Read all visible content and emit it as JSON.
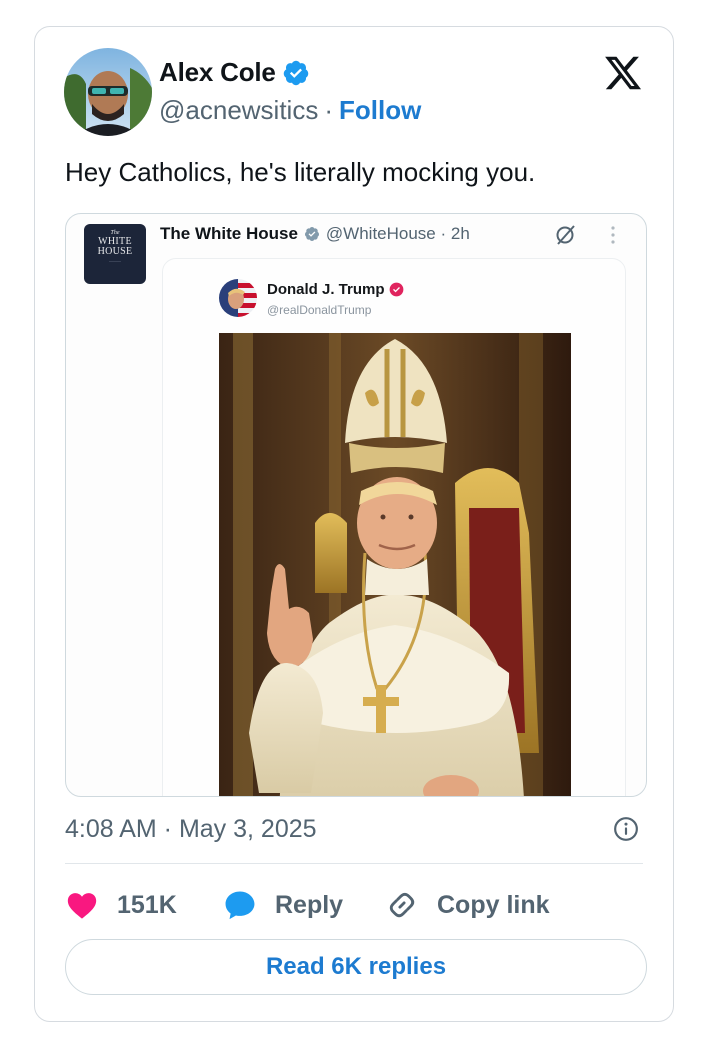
{
  "author": {
    "name": "Alex Cole",
    "handle": "@acnewsitics",
    "separator": "·",
    "follow_label": "Follow",
    "verified_icon": "verified-badge-icon",
    "accent_color": "#1d9bf0"
  },
  "platform_icon": "x-logo-icon",
  "tweet": {
    "text": "Hey Catholics, he's literally mocking you.",
    "timestamp": "4:08 AM · May 3, 2025"
  },
  "embedded_post": {
    "account_name": "The White House",
    "account_handle": "@WhiteHouse · 2h",
    "logo_text": {
      "line1": "The",
      "line2": "WHITE",
      "line3": "HOUSE"
    },
    "inner_post": {
      "name": "Donald J. Trump",
      "handle": "@realDonaldTrump"
    }
  },
  "actions": {
    "like_count": "151K",
    "reply_label": "Reply",
    "copy_label": "Copy link",
    "like_color": "#f91880"
  },
  "read_replies_label": "Read 6K replies"
}
